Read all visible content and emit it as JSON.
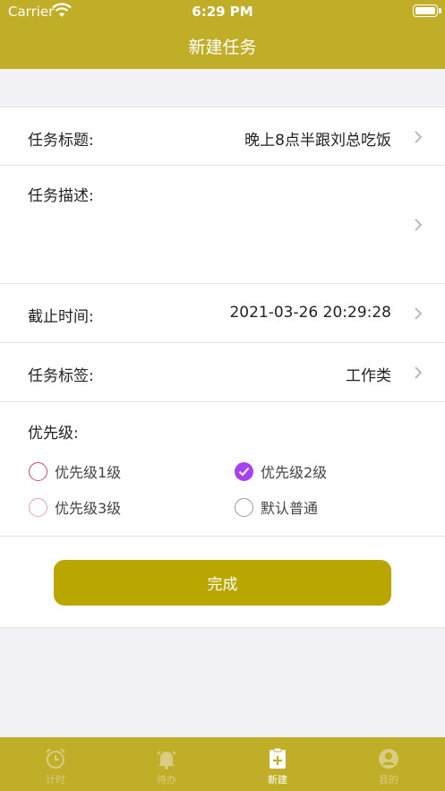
{
  "status_bar": {
    "carrier": "Carrier",
    "time": "6:29 PM"
  },
  "nav": {
    "title": "新建任务"
  },
  "form": {
    "title_label": "任务标题:",
    "title_value": "晚上8点半跟刘总吃饭",
    "desc_label": "任务描述:",
    "desc_value": "",
    "deadline_label": "截止时间:",
    "deadline_value": "2021-03-26 20:29:28",
    "tag_label": "任务标签:",
    "tag_value": "工作类",
    "priority_label": "优先级:",
    "priorities": [
      {
        "label": "优先级1级",
        "color": "#d14a5a",
        "selected": false
      },
      {
        "label": "优先级2级",
        "color": "#a640f0",
        "selected": true
      },
      {
        "label": "优先级3级",
        "color": "#eaa0b8",
        "selected": false
      },
      {
        "label": "默认普通",
        "color": "#999999",
        "selected": false
      }
    ],
    "submit_label": "完成"
  },
  "tabs": [
    {
      "label": "计时",
      "icon": "alarm-clock-icon",
      "active": false
    },
    {
      "label": "待办",
      "icon": "bell-icon",
      "active": false
    },
    {
      "label": "新建",
      "icon": "new-note-icon",
      "active": true
    },
    {
      "label": "我的",
      "icon": "profile-icon",
      "active": false
    }
  ],
  "colors": {
    "bar": "#c1ae28",
    "button": "#b9a600"
  }
}
